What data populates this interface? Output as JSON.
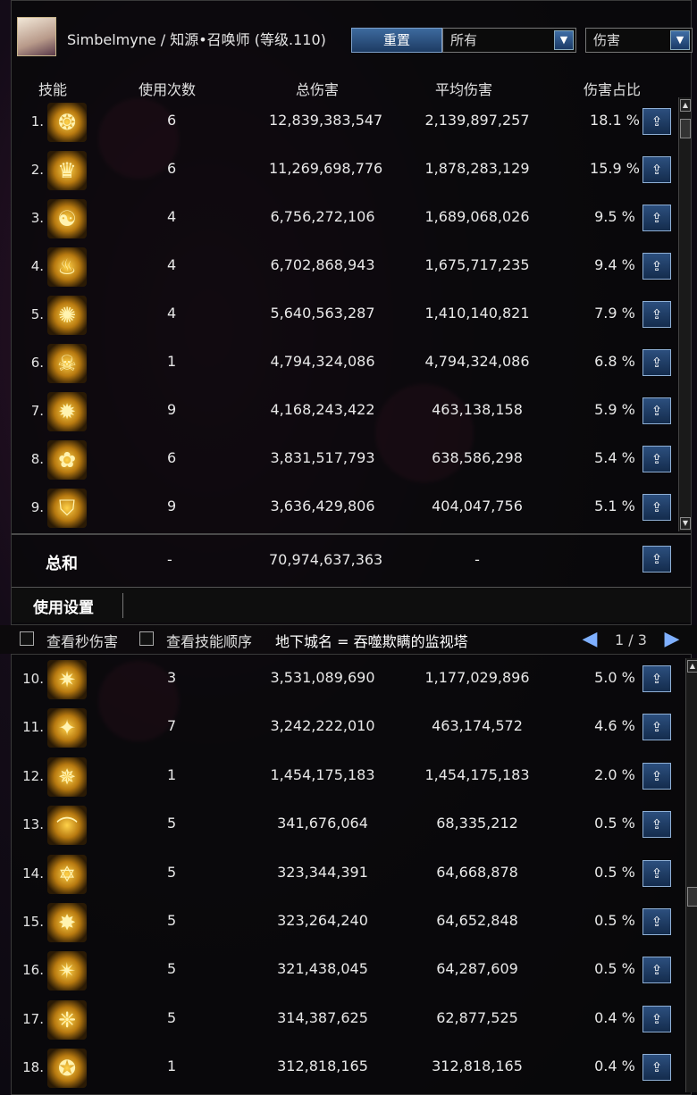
{
  "header": {
    "title": "Simbelmyne / 知源•召唤师 (等级.110)",
    "reset_label": "重置",
    "filter_select": "所有",
    "type_select": "伤害"
  },
  "columns": {
    "skill": "技能",
    "uses": "使用次数",
    "total": "总伤害",
    "avg": "平均伤害",
    "pct": "伤害占比"
  },
  "rows_top": [
    {
      "rank": "1.",
      "uses": "6",
      "total": "12,839,383,547",
      "avg": "2,139,897,257",
      "pct": "18.1 %"
    },
    {
      "rank": "2.",
      "uses": "6",
      "total": "11,269,698,776",
      "avg": "1,878,283,129",
      "pct": "15.9 %"
    },
    {
      "rank": "3.",
      "uses": "4",
      "total": "6,756,272,106",
      "avg": "1,689,068,026",
      "pct": "9.5 %"
    },
    {
      "rank": "4.",
      "uses": "4",
      "total": "6,702,868,943",
      "avg": "1,675,717,235",
      "pct": "9.4 %"
    },
    {
      "rank": "5.",
      "uses": "4",
      "total": "5,640,563,287",
      "avg": "1,410,140,821",
      "pct": "7.9 %"
    },
    {
      "rank": "6.",
      "uses": "1",
      "total": "4,794,324,086",
      "avg": "4,794,324,086",
      "pct": "6.8 %"
    },
    {
      "rank": "7.",
      "uses": "9",
      "total": "4,168,243,422",
      "avg": "463,138,158",
      "pct": "5.9 %"
    },
    {
      "rank": "8.",
      "uses": "6",
      "total": "3,831,517,793",
      "avg": "638,586,298",
      "pct": "5.4 %"
    },
    {
      "rank": "9.",
      "uses": "9",
      "total": "3,636,429,806",
      "avg": "404,047,756",
      "pct": "5.1 %"
    }
  ],
  "total": {
    "label": "总和",
    "uses": "-",
    "total": "70,974,637,363",
    "avg": "-"
  },
  "usage_label": "使用设置",
  "options": {
    "view_per_sec": "查看秒伤害",
    "view_order": "查看技能顺序",
    "dungeon": "地下城名 = 吞噬欺瞒的监视塔",
    "page": "1 / 3"
  },
  "rows_bottom": [
    {
      "rank": "10.",
      "uses": "3",
      "total": "3,531,089,690",
      "avg": "1,177,029,896",
      "pct": "5.0 %"
    },
    {
      "rank": "11.",
      "uses": "7",
      "total": "3,242,222,010",
      "avg": "463,174,572",
      "pct": "4.6 %"
    },
    {
      "rank": "12.",
      "uses": "1",
      "total": "1,454,175,183",
      "avg": "1,454,175,183",
      "pct": "2.0 %"
    },
    {
      "rank": "13.",
      "uses": "5",
      "total": "341,676,064",
      "avg": "68,335,212",
      "pct": "0.5 %"
    },
    {
      "rank": "14.",
      "uses": "5",
      "total": "323,344,391",
      "avg": "64,668,878",
      "pct": "0.5 %"
    },
    {
      "rank": "15.",
      "uses": "5",
      "total": "323,264,240",
      "avg": "64,652,848",
      "pct": "0.5 %"
    },
    {
      "rank": "16.",
      "uses": "5",
      "total": "321,438,045",
      "avg": "64,287,609",
      "pct": "0.5 %"
    },
    {
      "rank": "17.",
      "uses": "5",
      "total": "314,387,625",
      "avg": "62,877,525",
      "pct": "0.4 %"
    },
    {
      "rank": "18.",
      "uses": "1",
      "total": "312,818,165",
      "avg": "312,818,165",
      "pct": "0.4 %"
    }
  ],
  "icons": [
    "❂",
    "♛",
    "☯",
    "♨",
    "✺",
    "☠",
    "✹",
    "✿",
    "⛉",
    "✷",
    "✦",
    "✵",
    "⌒",
    "✡",
    "✸",
    "✴",
    "❈",
    "✪"
  ]
}
